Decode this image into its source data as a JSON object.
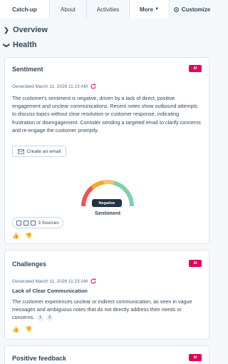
{
  "tabs": [
    {
      "label": "Catch-up",
      "active": true
    },
    {
      "label": "About",
      "active": false
    },
    {
      "label": "Activities",
      "active": false
    },
    {
      "label": "More",
      "active": false
    },
    {
      "label": "Customize",
      "active": false
    }
  ],
  "sections": {
    "overview": "Overview",
    "health": "Health"
  },
  "sentiment_card": {
    "title": "Sentiment",
    "badge": "AI",
    "generated": "Generated March 11, 2026 11:23 AM",
    "summary": "The customer's sentiment is negative, driven by a lack of direct, positive engagement and unclear communications. Recent notes show outbound attempts to discuss topics without clear resolution or customer response, indicating frustration or disengagement. Consider sending a targeted email to clarify concerns and re-engage the customer promptly.",
    "email_button": "Create an email",
    "gauge_value": "Negative",
    "gauge_level": 0.05,
    "gauge_label": "Sentiment",
    "sources_label": "3 Sources"
  },
  "challenges_card": {
    "title": "Challenges",
    "badge": "AI",
    "generated": "Generated March 11, 2026 11:23 AM",
    "subtitle": "Lack of Clear Communication",
    "body": "The customer experiences unclear or indirect communication, as seen in vague messages and ambiguous notes that do not directly address their needs or concerns.",
    "citations": [
      "1",
      "2"
    ]
  },
  "positive_card": {
    "title": "Positive feedback",
    "badge": "AI"
  },
  "colors": {
    "ai_badge": "#e6005c",
    "gauge_red": "#f2545b",
    "gauge_orange": "#f5a623",
    "gauge_yellow": "#f5c26b",
    "gauge_green": "#7fd1ae"
  },
  "icons": [
    "gear-icon",
    "chevron-right-icon",
    "chevron-down-icon",
    "refresh-sparkle-icon",
    "email-icon",
    "thumbs-up-icon",
    "thumbs-down-icon"
  ]
}
